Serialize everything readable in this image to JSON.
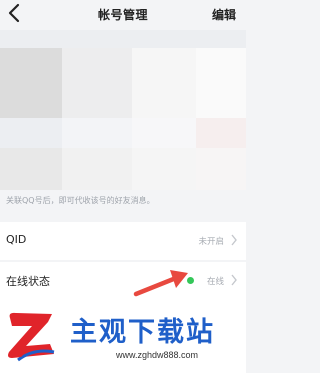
{
  "header": {
    "title": "帐号管理",
    "edit_label": "编辑",
    "back_icon": "chevron-left-icon"
  },
  "hint_text": "关联QQ号后，即可代收该号的好友消息。",
  "rows": [
    {
      "label": "QID",
      "value": "未开启"
    },
    {
      "label": "在线状态",
      "value": "在线",
      "status_color": "#34c759"
    }
  ],
  "watermark": {
    "name": "主观下载站",
    "url": "www.zghdw888.com",
    "logo_letter": "Z",
    "colors": {
      "logo_red": "#e0242a",
      "text_blue": "#1f5fc9"
    }
  },
  "annotation": {
    "arrow_color": "#e8493f"
  }
}
